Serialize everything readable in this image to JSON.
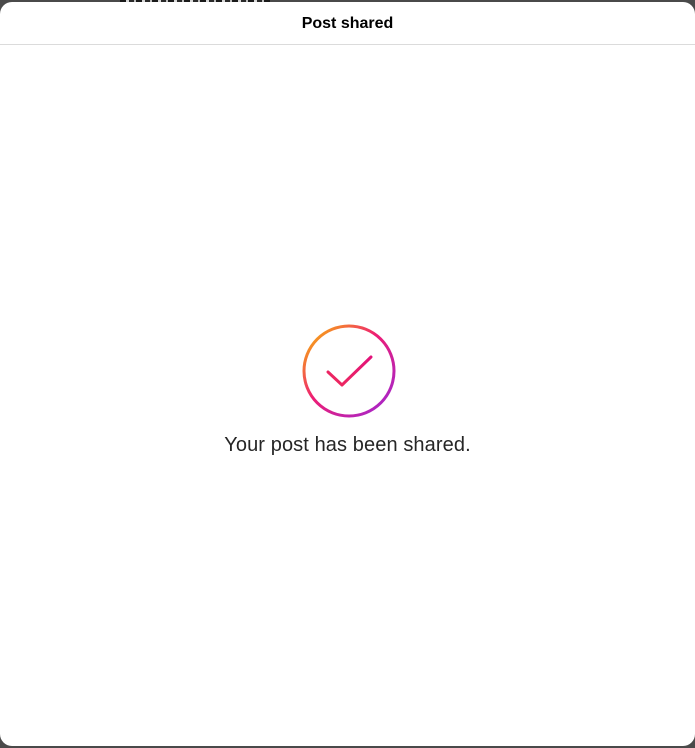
{
  "modal": {
    "title": "Post shared",
    "message": "Your post has been shared.",
    "icon": "check-circle-icon"
  },
  "colors": {
    "gradient_start": "#f9c400",
    "gradient_mid": "#ee1d74",
    "gradient_end": "#9b27d8",
    "divider": "#dbdbdb",
    "text": "#262626"
  }
}
